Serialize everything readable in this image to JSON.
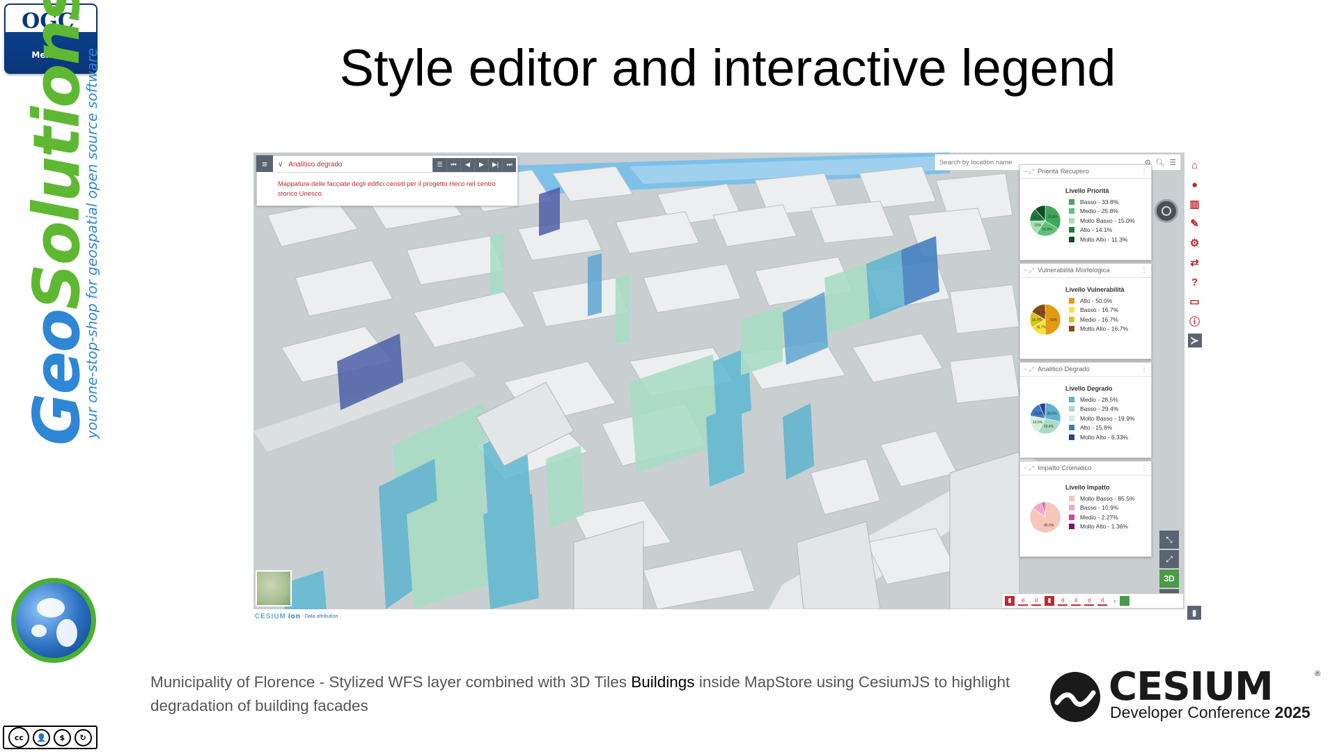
{
  "slide": {
    "title": "Style editor and interactive legend",
    "caption_before": "Municipality of Florence - Stylized WFS layer combined with 3D Tiles ",
    "caption_highlight": "Buildings",
    "caption_after": " inside MapStore using CesiumJS to highlight degradation of building facades"
  },
  "ogc_badge": {
    "name": "OGC",
    "tm": "®",
    "member": "Member"
  },
  "geosolutions": {
    "brand_geo": "Geo",
    "brand_solutions": "Solutions",
    "tagline": "your one-stop-shop for geospatial open source software"
  },
  "cc_license": {
    "cc": "cc",
    "by": "BY",
    "nc": "NC",
    "sa": "SA"
  },
  "cesium": {
    "word": "CESIUM",
    "reg": "®",
    "conference": "Developer Conference ",
    "year": "2025"
  },
  "mapstore": {
    "toc": {
      "layer_name": "Analitico degrado",
      "description": "Mappatura delle facciate degli edifici censiti per il progetto Heco nel centro storico Unesco.",
      "controls": [
        "☰",
        "⏮",
        "◀",
        "▶",
        "▶|",
        "⏭"
      ]
    },
    "search": {
      "placeholder": "Search by location name"
    },
    "footer": {
      "cesium": "CESIUM",
      "ion": "ion",
      "attribution": "Data attribution"
    },
    "legends": [
      {
        "title": "Priorità Recupero",
        "heading": "Livello Priorità",
        "items": [
          {
            "label": "Basso - 33.8%",
            "value": 33.8,
            "color": "#3fa65a"
          },
          {
            "label": "Medio - 25.8%",
            "value": 25.8,
            "color": "#62c07a"
          },
          {
            "label": "Molto Basso - 15.0%",
            "value": 15.0,
            "color": "#a6e0b0"
          },
          {
            "label": "Alto - 14.1%",
            "value": 14.1,
            "color": "#1f7a3c"
          },
          {
            "label": "Molto Alto - 11.3%",
            "value": 11.3,
            "color": "#0c4d22"
          }
        ],
        "pie_labels": [
          "33.8%",
          "25.8%",
          "15%",
          "14.1%"
        ]
      },
      {
        "title": "Vulnerabilità Morfologica",
        "heading": "Livello Vulnerabilità",
        "items": [
          {
            "label": "Alto - 50.0%",
            "value": 50.0,
            "color": "#e39a12"
          },
          {
            "label": "Basso - 16.7%",
            "value": 16.7,
            "color": "#f6e33a"
          },
          {
            "label": "Medio - 16.7%",
            "value": 16.7,
            "color": "#d8c516"
          },
          {
            "label": "Molto Alto - 16.7%",
            "value": 16.7,
            "color": "#8a4a12"
          }
        ],
        "pie_labels": [
          "50%",
          "16.7%",
          "16.7%",
          "16.7%"
        ]
      },
      {
        "title": "Analitico Degrado",
        "heading": "Livello Degrado",
        "items": [
          {
            "label": "Medio - 28.5%",
            "value": 28.5,
            "color": "#5db3cf"
          },
          {
            "label": "Basso - 29.4%",
            "value": 29.4,
            "color": "#a9dcc4"
          },
          {
            "label": "Molto Basso - 19.9%",
            "value": 19.9,
            "color": "#d3efdc"
          },
          {
            "label": "Alto - 15.8%",
            "value": 15.8,
            "color": "#3c7cc0"
          },
          {
            "label": "Molto Alto - 6.33%",
            "value": 6.33,
            "color": "#2b3f8f"
          }
        ],
        "pie_labels": [
          "28.5%",
          "29.4%",
          "19.9%",
          "15.8%"
        ]
      },
      {
        "title": "Impatto Cromatico",
        "heading": "Livello Impatto",
        "items": [
          {
            "label": "Molto Basso - 85.5%",
            "value": 85.5,
            "color": "#f7c6b8"
          },
          {
            "label": "Basso - 10.9%",
            "value": 10.9,
            "color": "#f3a6c4"
          },
          {
            "label": "Medio - 2.27%",
            "value": 2.27,
            "color": "#d9449a"
          },
          {
            "label": "Molto Alto - 1.36%",
            "value": 1.36,
            "color": "#8a0a6a"
          }
        ],
        "pie_labels": [
          "85.5%"
        ]
      }
    ],
    "map_controls": {
      "three_d": "3D",
      "more": "•••"
    },
    "accent_color": "#c0282e"
  }
}
